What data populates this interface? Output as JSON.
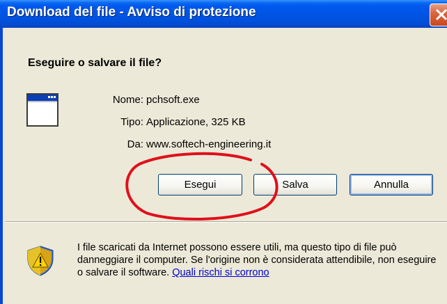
{
  "window": {
    "title": "Download del file - Avviso di protezione"
  },
  "dialog": {
    "heading": "Eseguire o salvare il file?",
    "file": {
      "name_label": "Nome:",
      "name_value": "pchsoft.exe",
      "type_label": "Tipo:",
      "type_value": "Applicazione, 325 KB",
      "from_label": "Da:",
      "from_value": "www.softech-engineering.it"
    },
    "buttons": {
      "run": "Esegui",
      "save": "Salva",
      "cancel": "Annulla"
    },
    "warning": {
      "text": "I file scaricati da Internet possono essere utili, ma questo tipo di file può danneggiare il computer. Se l'origine non è considerata attendibile, non eseguire o salvare il software.",
      "link": "Quali rischi si corrono"
    }
  },
  "icons": {
    "close": "close-icon",
    "application": "application-window-icon",
    "security": "security-shield-icon"
  },
  "colors": {
    "titlebar": "#0054e3",
    "close_button": "#d96742",
    "annotation_circle": "#e0101c",
    "link": "#0000cc",
    "dialog_background": "#ece9d8"
  }
}
